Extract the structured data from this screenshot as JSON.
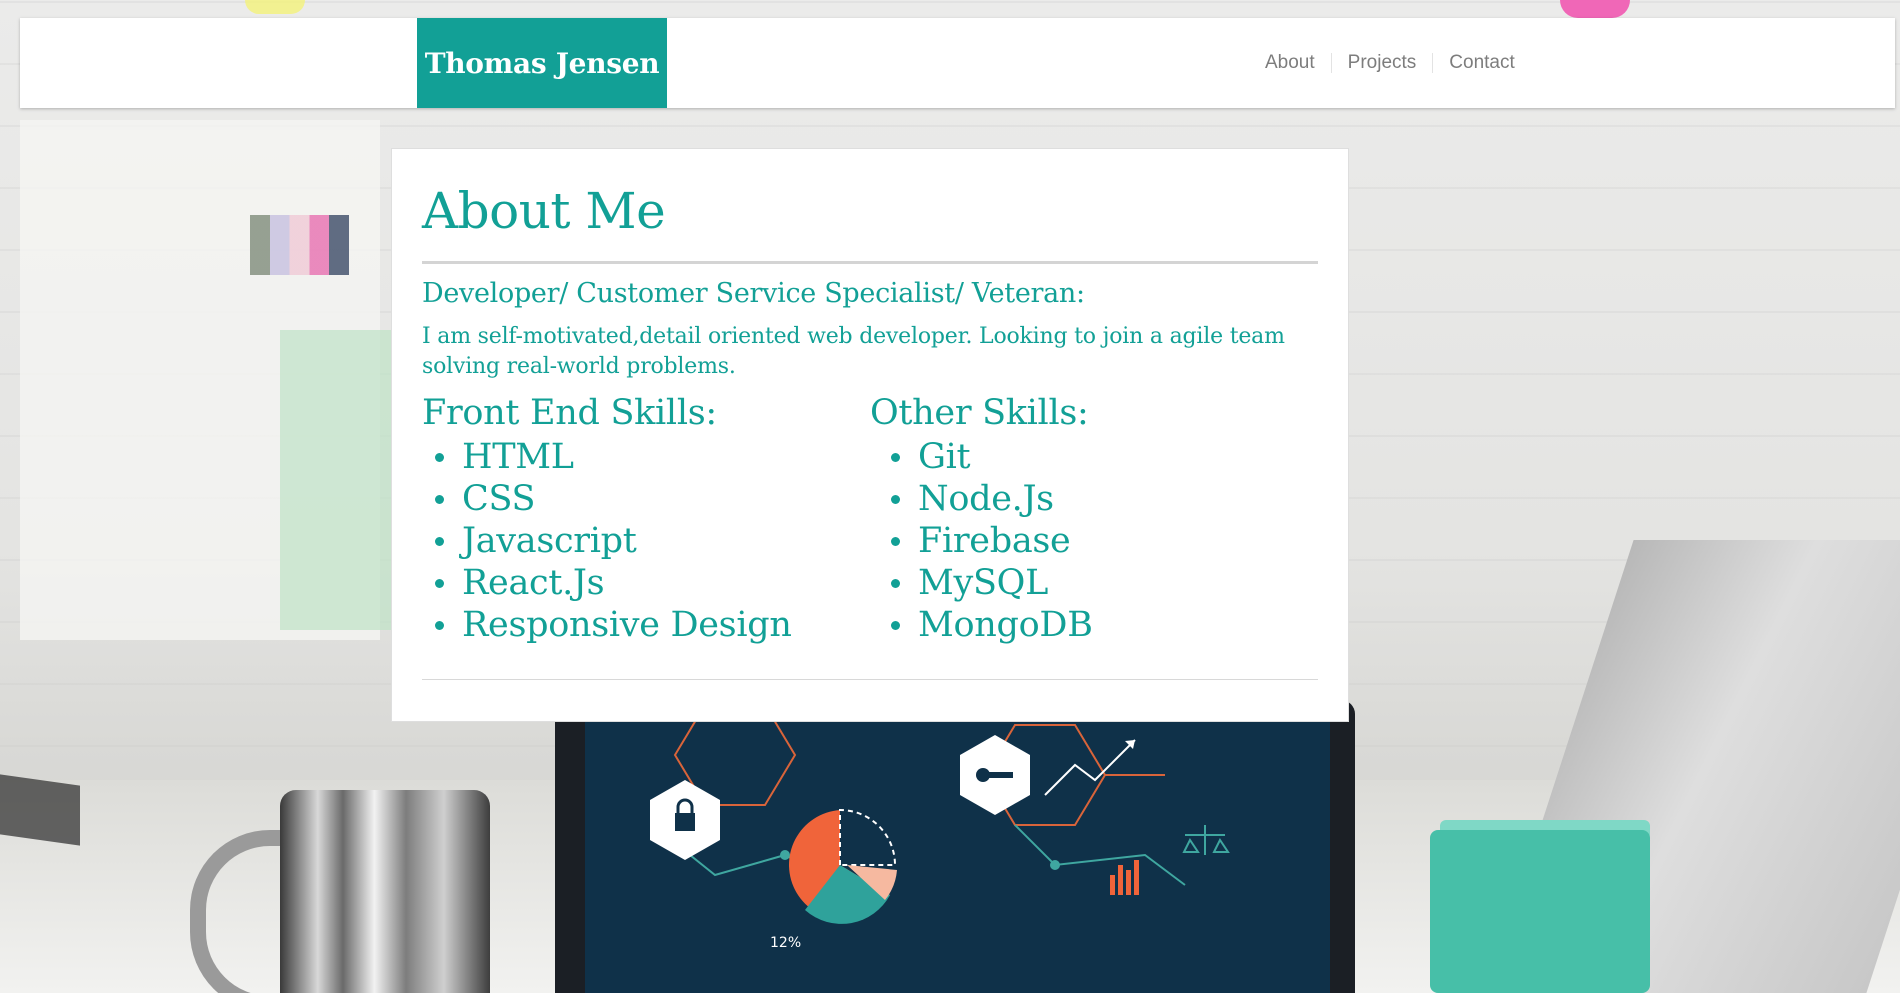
{
  "brand": {
    "name": "Thomas Jensen",
    "color": "#12a096"
  },
  "nav": {
    "items": [
      "About",
      "Projects",
      "Contact"
    ]
  },
  "about": {
    "title": "About Me",
    "subtitle": "Developer/ Customer Service Specialist/ Veteran:",
    "bio": "I am self-motivated,detail oriented web developer. Looking to join a agile team solving real-world problems.",
    "front_end": {
      "heading": "Front End Skills:",
      "items": [
        "HTML",
        "CSS",
        "Javascript",
        "React.Js",
        "Responsive Design"
      ]
    },
    "other": {
      "heading": "Other Skills:",
      "items": [
        "Git",
        "Node.Js",
        "Firebase",
        "MySQL",
        "MongoDB"
      ]
    }
  },
  "colors": {
    "accent": "#12a096",
    "nav_text": "#7d7d7d"
  }
}
